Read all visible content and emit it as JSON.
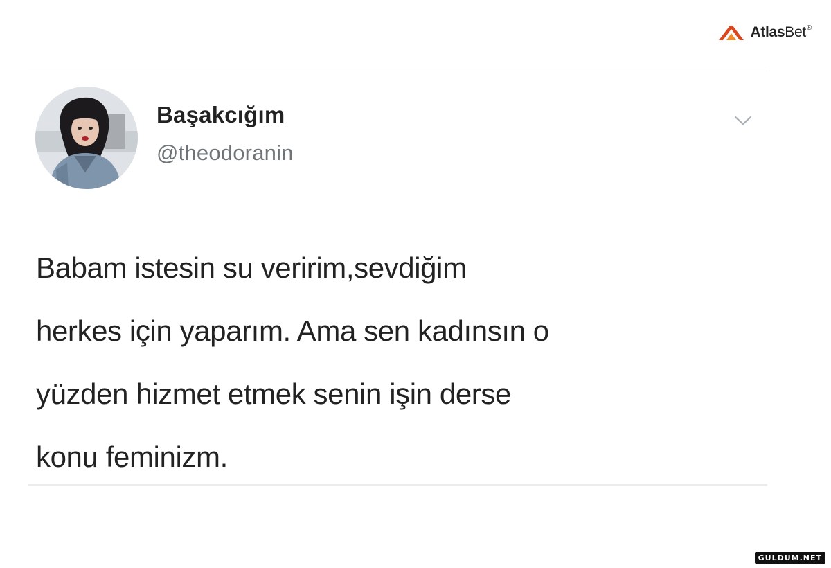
{
  "brand": {
    "name_bold": "Atlas",
    "name_light": "Bet",
    "registered": "®",
    "accent_color": "#d9471f"
  },
  "tweet": {
    "display_name": "Başakcığım",
    "handle": "@theodoranin",
    "menu_icon": "chevron-down-icon",
    "lines": [
      "Babam istesin su veririm,sevdiğim",
      "herkes için yaparım. Ama sen kadınsın o",
      "yüzden hizmet etmek senin işin derse",
      "konu feminizm."
    ]
  },
  "watermark": {
    "text": "GULDUM.NET"
  }
}
